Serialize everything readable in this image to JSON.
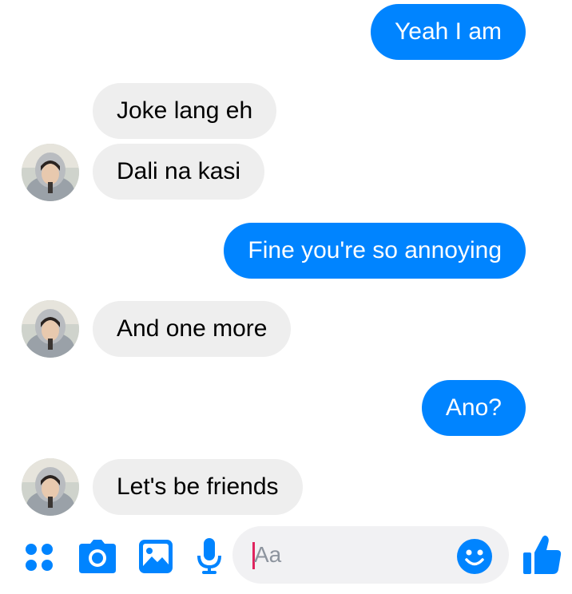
{
  "messages": [
    {
      "text": "Yeah I am",
      "direction": "out"
    },
    {
      "text": "Joke lang eh",
      "direction": "in"
    },
    {
      "text": "Dali na kasi",
      "direction": "in"
    },
    {
      "text": "Fine you're so annoying",
      "direction": "out"
    },
    {
      "text": "And one more",
      "direction": "in"
    },
    {
      "text": "Ano?",
      "direction": "out"
    },
    {
      "text": "Let's be friends",
      "direction": "in"
    }
  ],
  "composer": {
    "placeholder": "Aa",
    "icons": [
      "more-apps-icon",
      "camera-icon",
      "gallery-icon",
      "microphone-icon",
      "emoji-icon",
      "like-thumbs-up-icon"
    ]
  },
  "colors": {
    "outgoing_bubble": "#0084ff",
    "incoming_bubble": "#eeeeee",
    "accent": "#0084ff",
    "caret": "#e0245e"
  }
}
